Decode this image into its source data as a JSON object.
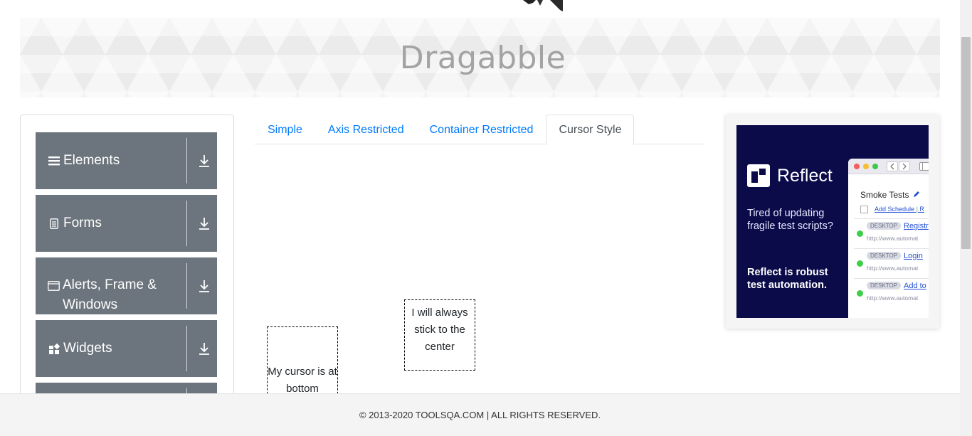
{
  "header": {
    "title": "Dragabble"
  },
  "sidebar": {
    "groups": [
      {
        "label": "Elements",
        "icon": "hamburger-icon"
      },
      {
        "label": "Forms",
        "icon": "document-icon"
      },
      {
        "label": "Alerts, Frame & Windows",
        "icon": "window-icon"
      },
      {
        "label": "Widgets",
        "icon": "widgets-icon"
      },
      {
        "label": "",
        "icon": ""
      }
    ]
  },
  "tabs": [
    {
      "label": "Simple",
      "active": false
    },
    {
      "label": "Axis Restricted",
      "active": false
    },
    {
      "label": "Container Restricted",
      "active": false
    },
    {
      "label": "Cursor Style",
      "active": true
    }
  ],
  "draggables": {
    "center": "I will always stick to the center",
    "bottom": "My cursor is at bottom"
  },
  "ad": {
    "brand": "Reflect",
    "tagline": "Tired of updating fragile test scripts?",
    "pitch": "Reflect is robust test automation.",
    "mock_title": "Smoke Tests",
    "mock_schedule": "Add Schedule",
    "mock_schedule_more": "R",
    "rows": [
      {
        "badge": "DESKTOP",
        "link": "Registr",
        "url": "http://www.automat"
      },
      {
        "badge": "DESKTOP",
        "link": "Login",
        "url": "http://www.automat"
      },
      {
        "badge": "DESKTOP",
        "link": "Add to",
        "url": "http://www.automat"
      }
    ]
  },
  "footer": {
    "text": "© 2013-2020 TOOLSQA.COM | ALL RIGHTS RESERVED."
  }
}
